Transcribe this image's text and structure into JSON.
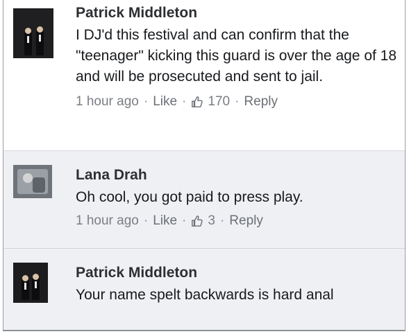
{
  "comments": [
    {
      "author": "Patrick Middleton",
      "text": "I DJ'd this festival and can confirm that the \"teenager\" kicking this guard is over the age of 18 and will be prosecuted and sent to jail.",
      "time": "1 hour ago",
      "like_label": "Like",
      "like_count": "170",
      "reply_label": "Reply"
    },
    {
      "author": "Lana Drah",
      "text": "Oh cool, you got paid to press play.",
      "time": "1 hour ago",
      "like_label": "Like",
      "like_count": "3",
      "reply_label": "Reply"
    },
    {
      "author": "Patrick Middleton",
      "text": "Your name spelt backwards is hard anal"
    }
  ],
  "icons": {
    "like": "thumbs-up-icon",
    "separator": "·"
  }
}
